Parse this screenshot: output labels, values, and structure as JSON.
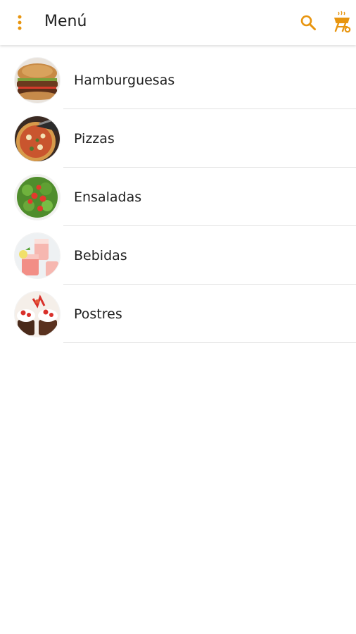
{
  "app_bar": {
    "title": "Menú",
    "menu_icon": "more-vertical-icon",
    "search_icon": "search-icon",
    "cart_icon": "grill-cart-icon"
  },
  "colors": {
    "accent": "#E8950F",
    "divider": "#e3e3e3",
    "text": "#1f1f1f"
  },
  "categories": [
    {
      "label": "Hamburguesas",
      "icon": "hamburger-photo"
    },
    {
      "label": "Pizzas",
      "icon": "pizza-photo"
    },
    {
      "label": "Ensaladas",
      "icon": "salad-photo"
    },
    {
      "label": "Bebidas",
      "icon": "drinks-photo"
    },
    {
      "label": "Postres",
      "icon": "dessert-photo"
    }
  ]
}
